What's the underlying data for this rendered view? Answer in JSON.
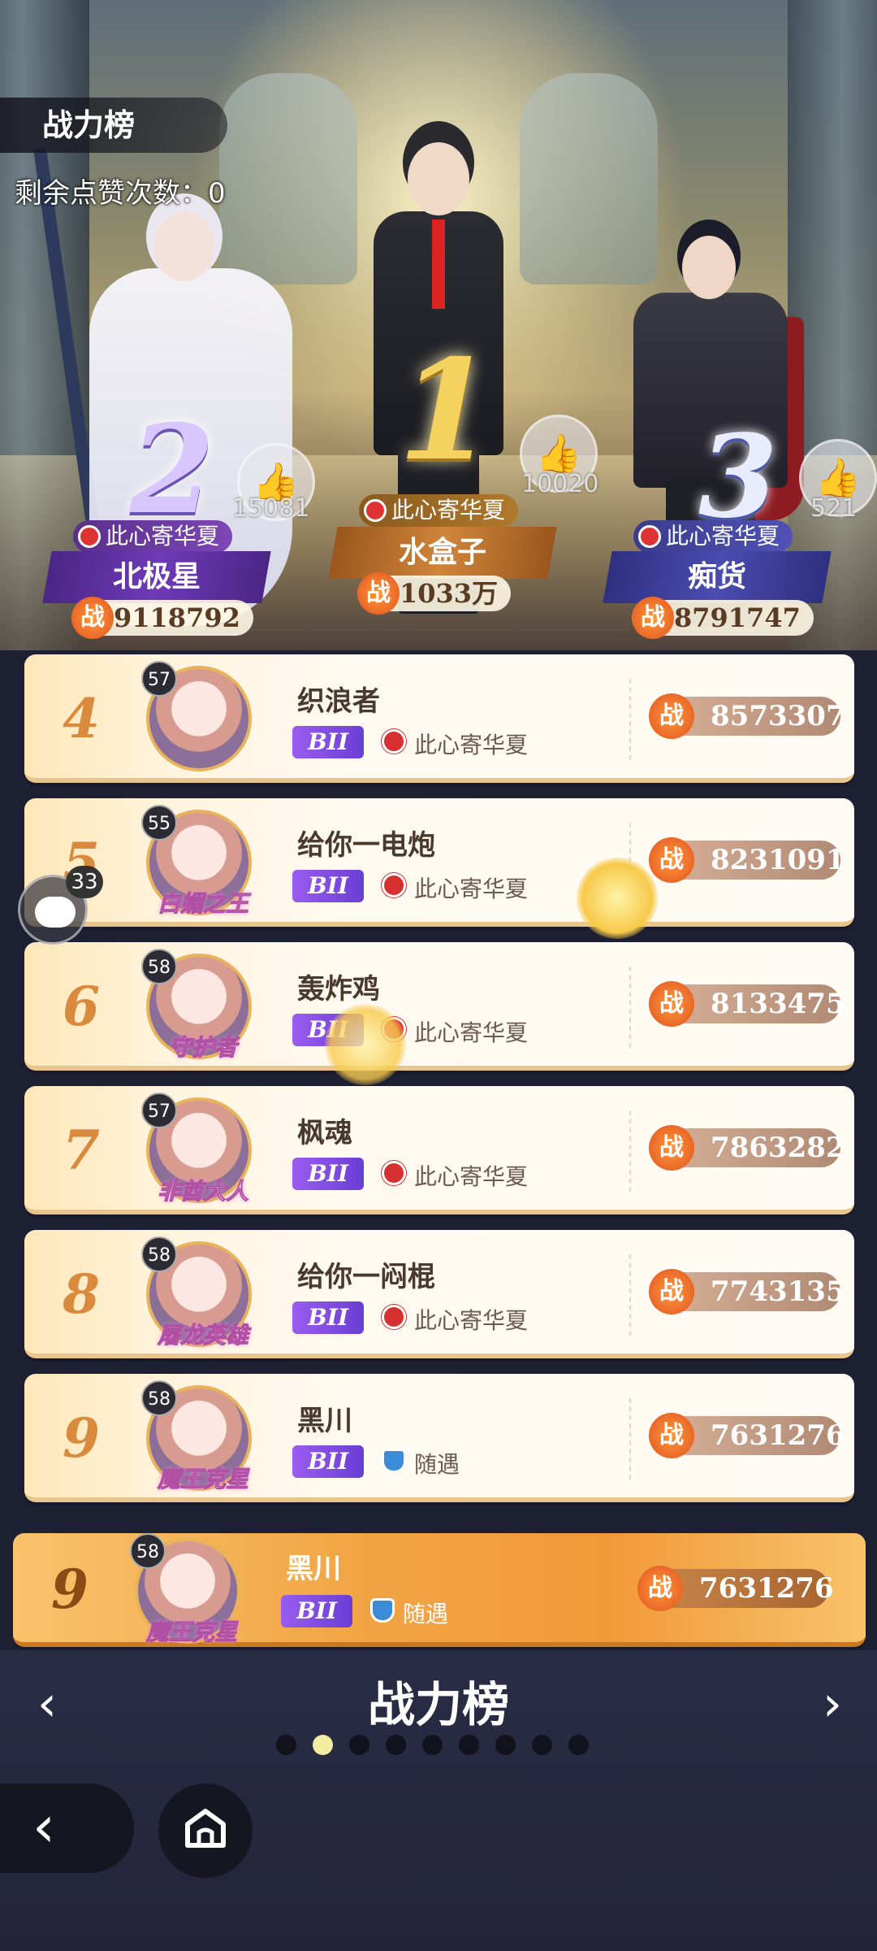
{
  "header": {
    "title": "战力榜",
    "likes_remaining": "剩余点赞次数：0"
  },
  "podium": [
    {
      "rank": "1",
      "guild": "此心寄华夏",
      "name": "水盒子",
      "power": "1033万",
      "likes": "10020"
    },
    {
      "rank": "2",
      "guild": "此心寄华夏",
      "name": "北极星",
      "power": "9118792",
      "likes": "15081"
    },
    {
      "rank": "3",
      "guild": "此心寄华夏",
      "name": "痴货",
      "power": "8791747",
      "likes": "521"
    }
  ],
  "power_symbol": "战",
  "list": [
    {
      "rank": "4",
      "level": "57",
      "name": "织浪者",
      "badge": "BII",
      "guild": "此心寄华夏",
      "power": "8573307",
      "avatar_title": ""
    },
    {
      "rank": "5",
      "level": "55",
      "name": "给你一电炮",
      "badge": "BII",
      "guild": "此心寄华夏",
      "power": "8231091",
      "avatar_title": "白媚之王"
    },
    {
      "rank": "6",
      "level": "58",
      "name": "轰炸鸡",
      "badge": "BII",
      "guild": "此心寄华夏",
      "power": "8133475",
      "avatar_title": "守护者"
    },
    {
      "rank": "7",
      "level": "57",
      "name": "枫魂",
      "badge": "BII",
      "guild": "此心寄华夏",
      "power": "7863282",
      "avatar_title": "非酋大人"
    },
    {
      "rank": "8",
      "level": "58",
      "name": "给你一闷棍",
      "badge": "BII",
      "guild": "此心寄华夏",
      "power": "7743135",
      "avatar_title": "屠龙英雄"
    },
    {
      "rank": "9",
      "level": "58",
      "name": "黑川",
      "badge": "BII",
      "guild": "随遇",
      "power": "7631276",
      "avatar_title": "魔王克星"
    }
  ],
  "self_row": {
    "rank": "9",
    "level": "58",
    "name": "黑川",
    "badge": "BII",
    "guild": "随遇",
    "power": "7631276",
    "avatar_title": "魔王克星"
  },
  "chat": {
    "count": "33"
  },
  "footer": {
    "title": "战力榜",
    "prev_icon": "chevron-left-icon",
    "next_icon": "chevron-right-icon",
    "page_count": 9,
    "active_page": 2
  },
  "colors": {
    "accent_orange": "#f19a3a",
    "badge_purple": "#8a4fe6",
    "guild_red": "#d73030",
    "dark_bg": "#23243a"
  }
}
